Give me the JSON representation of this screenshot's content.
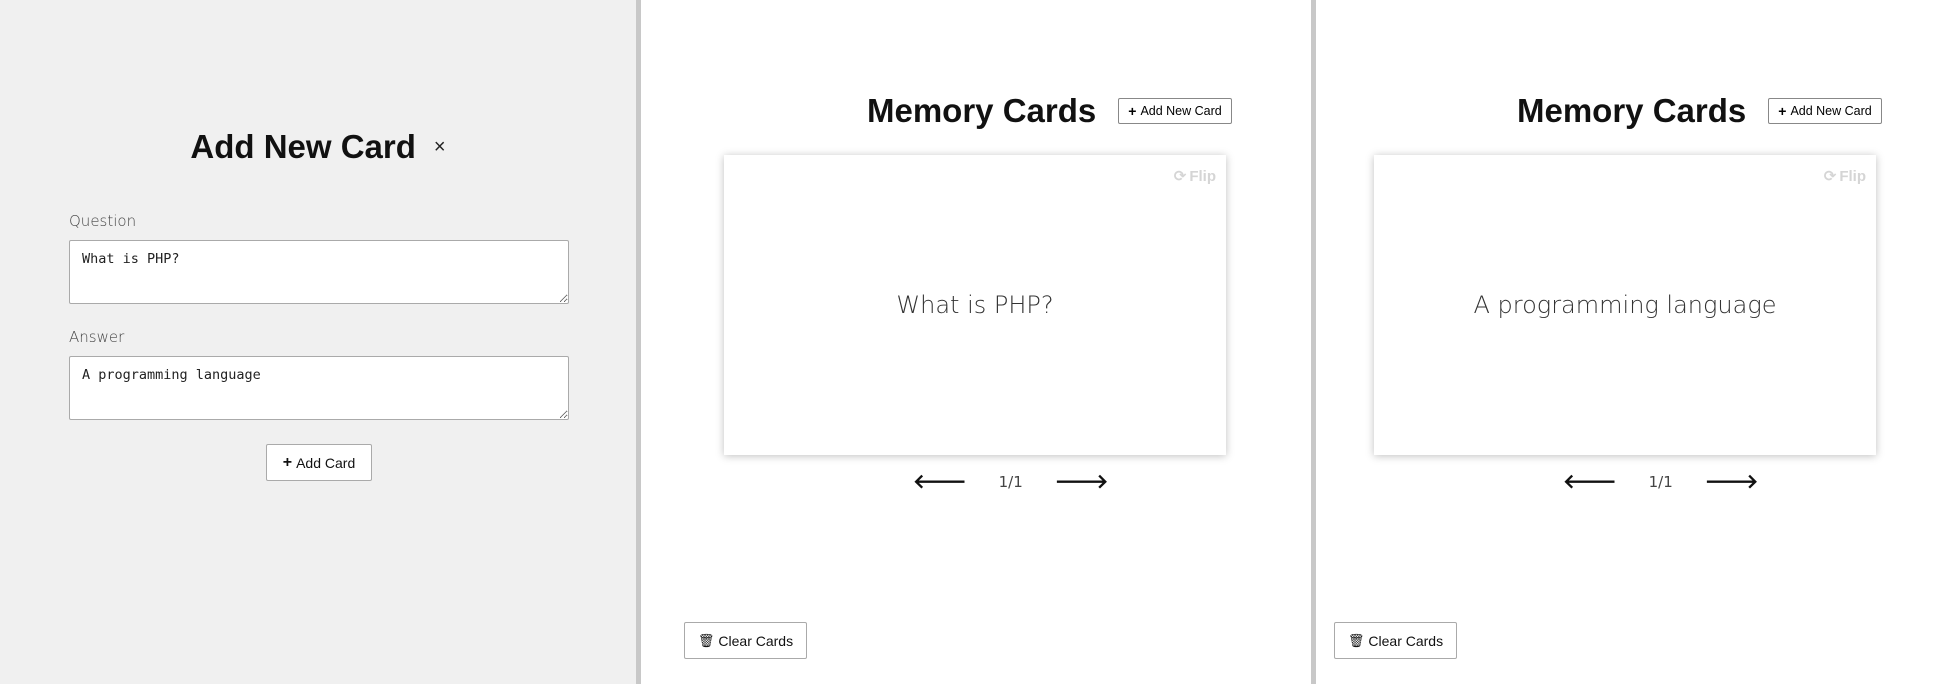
{
  "add_panel": {
    "title": "Add New Card",
    "close_symbol": "×",
    "question_label": "Question",
    "question_value": "What is PHP?",
    "answer_label": "Answer",
    "answer_value": "A programming language",
    "add_button_label": "Add Card",
    "add_button_icon": "+"
  },
  "views": [
    {
      "title": "Memory Cards",
      "add_new_label": "Add New Card",
      "add_new_icon": "+",
      "flip_label": "Flip",
      "flip_icon": "⟳",
      "card_text": "What is PHP?",
      "prev_icon": "🡐",
      "next_icon": "🡒",
      "counter": "1/1",
      "clear_label": "Clear Cards",
      "clear_icon": "🗑"
    },
    {
      "title": "Memory Cards",
      "add_new_label": "Add New Card",
      "add_new_icon": "+",
      "flip_label": "Flip",
      "flip_icon": "⟳",
      "card_text": "A programming language",
      "prev_icon": "🡐",
      "next_icon": "🡒",
      "counter": "1/1",
      "clear_label": "Clear Cards",
      "clear_icon": "🗑"
    }
  ],
  "colors": {
    "add_panel_bg": "#f0f0f0",
    "divider": "#c8c8c8",
    "flip_text": "#d5d5d5"
  }
}
